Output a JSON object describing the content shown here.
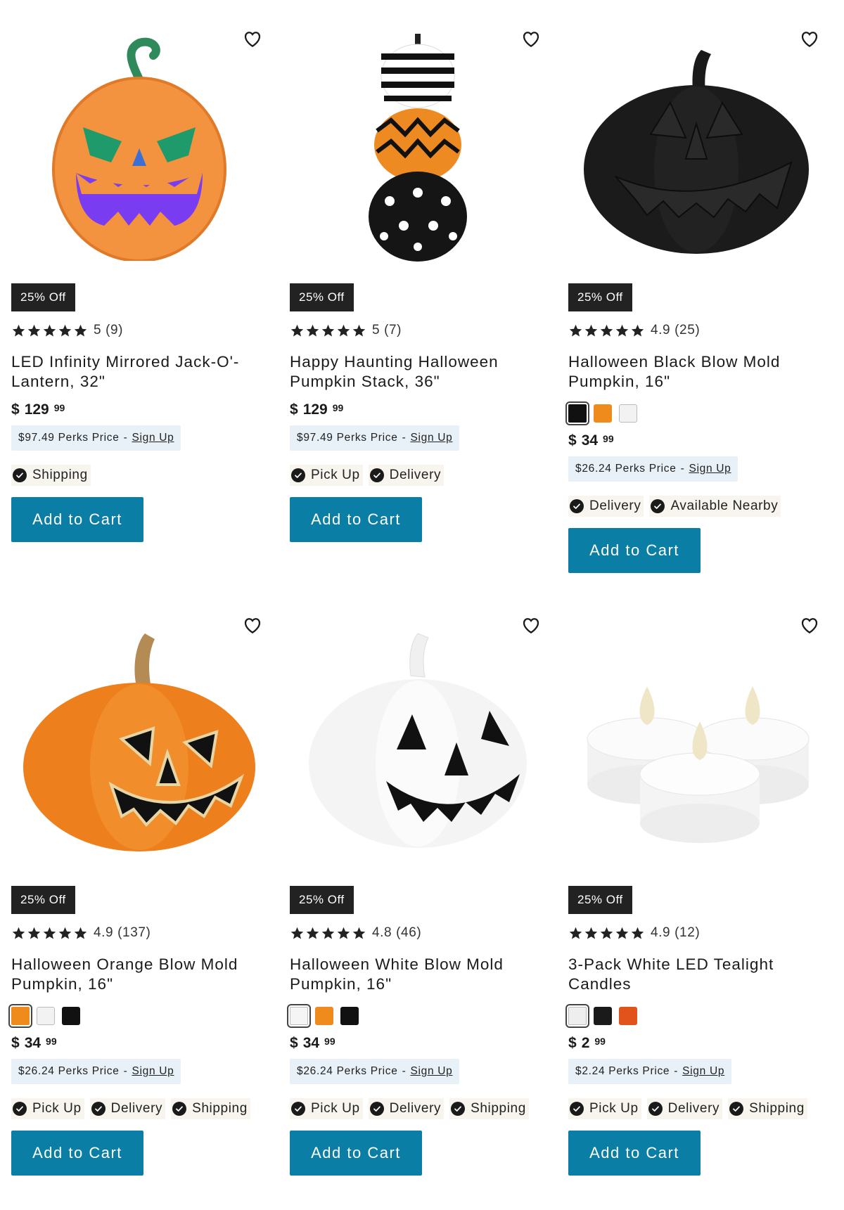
{
  "colors": {
    "button_bg": "#0a7ea4",
    "badge_bg": "#222222",
    "perks_bg": "#e8f1f8",
    "fulfillment_bg": "#f7f5ee"
  },
  "products": [
    {
      "badge": "25% Off",
      "rating_value": "5",
      "rating_count": "(9)",
      "stars_filled": 5,
      "title": "LED Infinity Mirrored Jack-O'-Lantern, 32\"",
      "currency": "$",
      "price_dollars": "129",
      "price_cents": "99",
      "perks_price": "$97.49 Perks Price",
      "perks_sep": "-",
      "sign_up": "Sign Up",
      "fulfillment": [
        "Shipping"
      ],
      "button": "Add to Cart",
      "image": "led-jack-o-lantern",
      "swatches": []
    },
    {
      "badge": "25% Off",
      "rating_value": "5",
      "rating_count": "(7)",
      "stars_filled": 5,
      "title": "Happy Haunting Halloween Pumpkin Stack, 36\"",
      "currency": "$",
      "price_dollars": "129",
      "price_cents": "99",
      "perks_price": "$97.49 Perks Price",
      "perks_sep": "-",
      "sign_up": "Sign Up",
      "fulfillment": [
        "Pick Up",
        "Delivery"
      ],
      "button": "Add to Cart",
      "image": "pumpkin-stack",
      "swatches": []
    },
    {
      "badge": "25% Off",
      "rating_value": "4.9",
      "rating_count": "(25)",
      "stars_filled": 5,
      "title": "Halloween Black Blow Mold Pumpkin, 16\"",
      "currency": "$",
      "price_dollars": "34",
      "price_cents": "99",
      "perks_price": "$26.24 Perks Price",
      "perks_sep": "-",
      "sign_up": "Sign Up",
      "fulfillment": [
        "Delivery",
        "Available Nearby"
      ],
      "button": "Add to Cart",
      "image": "black-blow-mold-pumpkin",
      "swatches": [
        {
          "color": "#111111",
          "selected": true
        },
        {
          "color": "#ef8a1c",
          "selected": false
        },
        {
          "color": "#f2f2f2",
          "selected": false
        }
      ]
    },
    {
      "badge": "25% Off",
      "rating_value": "4.9",
      "rating_count": "(137)",
      "stars_filled": 5,
      "title": "Halloween Orange Blow Mold Pumpkin, 16\"",
      "currency": "$",
      "price_dollars": "34",
      "price_cents": "99",
      "perks_price": "$26.24 Perks Price",
      "perks_sep": "-",
      "sign_up": "Sign Up",
      "fulfillment": [
        "Pick Up",
        "Delivery",
        "Shipping"
      ],
      "button": "Add to Cart",
      "image": "orange-blow-mold-pumpkin",
      "swatches": [
        {
          "color": "#ef8a1c",
          "selected": true
        },
        {
          "color": "#f2f2f2",
          "selected": false
        },
        {
          "color": "#111111",
          "selected": false
        }
      ]
    },
    {
      "badge": "25% Off",
      "rating_value": "4.8",
      "rating_count": "(46)",
      "stars_filled": 5,
      "title": "Halloween White Blow Mold Pumpkin, 16\"",
      "currency": "$",
      "price_dollars": "34",
      "price_cents": "99",
      "perks_price": "$26.24 Perks Price",
      "perks_sep": "-",
      "sign_up": "Sign Up",
      "fulfillment": [
        "Pick Up",
        "Delivery",
        "Shipping"
      ],
      "button": "Add to Cart",
      "image": "white-blow-mold-pumpkin",
      "swatches": [
        {
          "color": "#f5f5f5",
          "selected": true
        },
        {
          "color": "#ef8a1c",
          "selected": false
        },
        {
          "color": "#111111",
          "selected": false
        }
      ]
    },
    {
      "badge": "25% Off",
      "rating_value": "4.9",
      "rating_count": "(12)",
      "stars_filled": 5,
      "title": "3-Pack White LED Tealight Candles",
      "currency": "$",
      "price_dollars": "2",
      "price_cents": "99",
      "perks_price": "$2.24 Perks Price",
      "perks_sep": "-",
      "sign_up": "Sign Up",
      "fulfillment": [
        "Pick Up",
        "Delivery",
        "Shipping"
      ],
      "button": "Add to Cart",
      "image": "led-tealight-candles",
      "swatches": [
        {
          "color": "#eeeeee",
          "selected": true
        },
        {
          "color": "#1a1a1a",
          "selected": false
        },
        {
          "color": "#e2531c",
          "selected": false
        }
      ]
    }
  ]
}
